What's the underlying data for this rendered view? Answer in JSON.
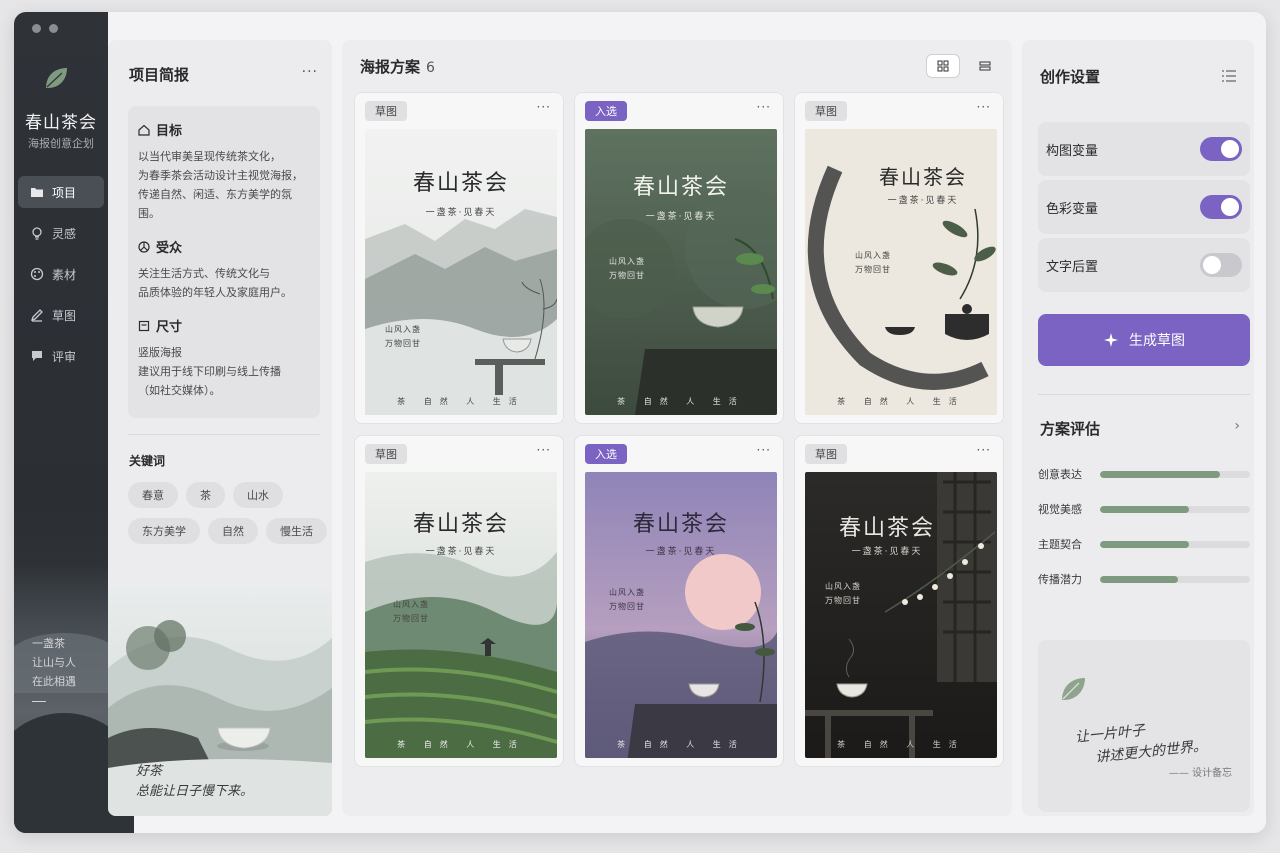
{
  "app": {
    "name": "春山茶会",
    "subtitle": "海报创意企划"
  },
  "nav": {
    "items": [
      {
        "label": "项目",
        "icon": "folder-icon",
        "active": true
      },
      {
        "label": "灵感",
        "icon": "lightbulb-icon",
        "active": false
      },
      {
        "label": "素材",
        "icon": "palette-icon",
        "active": false
      },
      {
        "label": "草图",
        "icon": "pencil-icon",
        "active": false
      },
      {
        "label": "评审",
        "icon": "comment-icon",
        "active": false
      }
    ],
    "poem": [
      "一盏茶",
      "让山与人",
      "在此相遇"
    ]
  },
  "brief": {
    "title": "项目简报",
    "more": "···",
    "sections": [
      {
        "heading": "目标",
        "icon": "home-icon",
        "text": "以当代审美呈现传统茶文化，\n为春季茶会活动设计主视觉海报，\n传递自然、闲适、东方美学的氛围。"
      },
      {
        "heading": "受众",
        "icon": "users-icon",
        "text": "关注生活方式、传统文化与\n品质体验的年轻人及家庭用户。"
      },
      {
        "heading": "尺寸",
        "icon": "frame-icon",
        "text": "竖版海报\n建议用于线下印刷与线上传播\n（如社交媒体）。"
      }
    ],
    "keywords_title": "关键词",
    "keywords": [
      "春意",
      "茶",
      "山水",
      "东方美学",
      "自然",
      "慢生活"
    ],
    "art_poem": [
      "好茶",
      "总能让日子慢下来。"
    ]
  },
  "posters": {
    "title": "海报方案",
    "count": "6",
    "view_modes": [
      "grid-view-icon",
      "list-view-icon"
    ],
    "items": [
      {
        "badge": "草图",
        "status": "draft",
        "title": "春山茶会",
        "subtitle": "一盏茶·见春天",
        "verse": [
          "山风入盏",
          "万物回甘"
        ],
        "footer": "茶 自然 人 生活",
        "theme": "mist"
      },
      {
        "badge": "入选",
        "status": "picked",
        "title": "春山茶会",
        "subtitle": "一盏茶·见春天",
        "verse": [
          "山风入盏",
          "万物回甘"
        ],
        "footer": "茶 自然 人 生活",
        "theme": "forest"
      },
      {
        "badge": "草图",
        "status": "draft",
        "title": "春山茶会",
        "subtitle": "一盏茶·见春天",
        "verse": [
          "山风入盏",
          "万物回甘"
        ],
        "footer": "茶 自然 人 生活",
        "theme": "ink"
      },
      {
        "badge": "草图",
        "status": "draft",
        "title": "春山茶会",
        "subtitle": "一盏茶·见春天",
        "verse": [
          "山风入盏",
          "万物回甘"
        ],
        "footer": "茶 自然 人 生活",
        "theme": "terrace"
      },
      {
        "badge": "入选",
        "status": "picked",
        "title": "春山茶会",
        "subtitle": "一盏茶·见春天",
        "verse": [
          "山风入盏",
          "万物回甘"
        ],
        "footer": "茶 自然 人 生活",
        "theme": "dusk"
      },
      {
        "badge": "草图",
        "status": "draft",
        "title": "春山茶会",
        "subtitle": "一盏茶·见春天",
        "verse": [
          "山风入盏",
          "万物回甘"
        ],
        "footer": "茶 自然 人 生活",
        "theme": "night"
      }
    ]
  },
  "settings": {
    "title": "创作设置",
    "toggles": [
      {
        "label": "构图变量",
        "on": true
      },
      {
        "label": "色彩变量",
        "on": true
      },
      {
        "label": "文字后置",
        "on": false
      }
    ],
    "generate_label": "生成草图",
    "eval_title": "方案评估",
    "eval_chevron": "›",
    "metrics": [
      {
        "label": "创意表达",
        "value": 0.8
      },
      {
        "label": "视觉美感",
        "value": 0.59
      },
      {
        "label": "主题契合",
        "value": 0.59
      },
      {
        "label": "传播潜力",
        "value": 0.52
      }
    ],
    "memo_text": [
      "让一片叶子",
      "讲述更大的世界。"
    ],
    "memo_sign": "—— 设计备忘"
  },
  "colors": {
    "accent": "#7a63c2",
    "metric_bar": "#7e9a7f",
    "rail": "#2f3338"
  }
}
